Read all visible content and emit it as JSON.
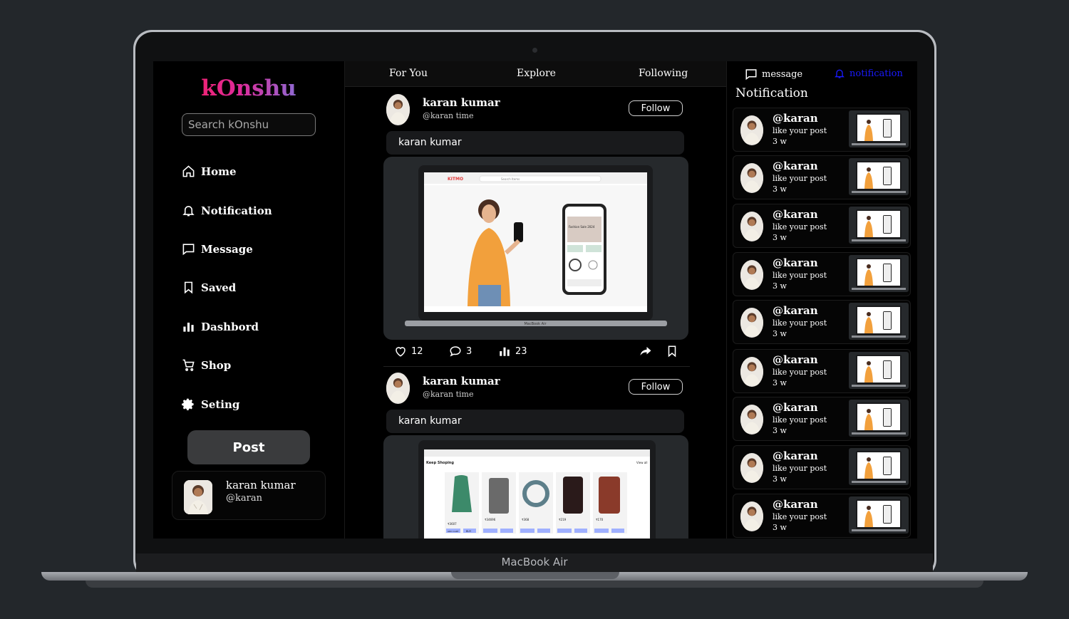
{
  "device": {
    "chin_label": "MacBook Air"
  },
  "sidebar": {
    "logo": "kOnshu",
    "search_placeholder": "Search kOnshu",
    "nav": [
      {
        "label": "Home",
        "icon": "home-icon"
      },
      {
        "label": "Notification",
        "icon": "bell-icon"
      },
      {
        "label": "Message",
        "icon": "message-icon"
      },
      {
        "label": "Saved",
        "icon": "bookmark-icon"
      },
      {
        "label": "Dashbord",
        "icon": "bar-chart-icon"
      },
      {
        "label": "Shop",
        "icon": "cart-icon"
      },
      {
        "label": "Seting",
        "icon": "gear-icon"
      }
    ],
    "post_button": "Post",
    "profile": {
      "name": "karan kumar",
      "handle": "@karan"
    }
  },
  "tabs": [
    "For You",
    "Explore",
    "Following"
  ],
  "posts": [
    {
      "name": "karan kumar",
      "handle": "@karan time",
      "follow": "Follow",
      "text": "karan kumar",
      "likes": "12",
      "comments": "3",
      "views": "23",
      "media": {
        "brand": "KITMO",
        "search": "Search Items",
        "device_label": "MacBook Air",
        "phone_banner": "Fashion Sale 2024"
      }
    },
    {
      "name": "karan kumar",
      "handle": "@karan time",
      "follow": "Follow",
      "text": "karan kumar",
      "media": {
        "section": "Keep Shoping",
        "view_all": "View all",
        "prices": [
          "₹3607",
          "₹34696",
          "₹368",
          "₹219",
          "₹170"
        ],
        "buy": "BUY",
        "add": "ADD CART"
      }
    }
  ],
  "right": {
    "message_label": "message",
    "notification_label": "notification",
    "title": "Notification",
    "items": [
      {
        "user": "@karan",
        "text": "like your post",
        "time": "3 w"
      },
      {
        "user": "@karan",
        "text": "like your post",
        "time": "3 w"
      },
      {
        "user": "@karan",
        "text": "like your post",
        "time": "3 w"
      },
      {
        "user": "@karan",
        "text": "like your post",
        "time": "3 w"
      },
      {
        "user": "@karan",
        "text": "like your post",
        "time": "3 w"
      },
      {
        "user": "@karan",
        "text": "like your post",
        "time": "3 w"
      },
      {
        "user": "@karan",
        "text": "like your post",
        "time": "3 w"
      },
      {
        "user": "@karan",
        "text": "like your post",
        "time": "3 w"
      },
      {
        "user": "@karan",
        "text": "like your post",
        "time": "3 w"
      }
    ]
  },
  "colors": {
    "accent_notification": "#1a1aff",
    "panel": "#191a1c",
    "background": "#000000"
  }
}
